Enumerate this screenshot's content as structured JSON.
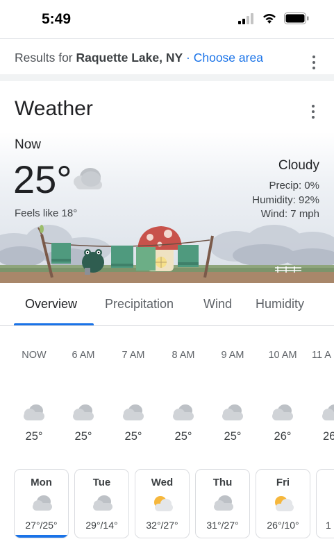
{
  "status": {
    "time": "5:49"
  },
  "results": {
    "prefix": "Results for ",
    "location": "Raquette Lake, NY",
    "separator": " · ",
    "choose_area": "Choose area"
  },
  "weather": {
    "title": "Weather",
    "now_label": "Now",
    "temperature": "25°",
    "feels_like": "Feels like 18°",
    "condition": "Cloudy",
    "precip": "Precip: 0%",
    "humidity": "Humidity: 92%",
    "wind": "Wind: 7 mph",
    "condition_icon": "cloud-icon"
  },
  "tabs": [
    {
      "label": "Overview",
      "active": true
    },
    {
      "label": "Precipitation",
      "active": false
    },
    {
      "label": "Wind",
      "active": false
    },
    {
      "label": "Humidity",
      "active": false
    }
  ],
  "hourly": [
    {
      "time": "NOW",
      "temp": "25°",
      "icon": "cloud-icon"
    },
    {
      "time": "6 AM",
      "temp": "25°",
      "icon": "cloud-icon"
    },
    {
      "time": "7 AM",
      "temp": "25°",
      "icon": "cloud-icon"
    },
    {
      "time": "8 AM",
      "temp": "25°",
      "icon": "cloud-icon"
    },
    {
      "time": "9 AM",
      "temp": "25°",
      "icon": "cloud-icon"
    },
    {
      "time": "10 AM",
      "temp": "26°",
      "icon": "cloud-icon"
    },
    {
      "time": "11 A",
      "temp": "26",
      "icon": "cloud-icon"
    }
  ],
  "daily": [
    {
      "day": "Mon",
      "temps": "27°/25°",
      "icon": "cloud-icon",
      "selected": true
    },
    {
      "day": "Tue",
      "temps": "29°/14°",
      "icon": "cloud-icon",
      "selected": false
    },
    {
      "day": "Wed",
      "temps": "32°/27°",
      "icon": "partly-sunny-icon",
      "selected": false
    },
    {
      "day": "Thu",
      "temps": "31°/27°",
      "icon": "cloud-icon",
      "selected": false
    },
    {
      "day": "Fri",
      "temps": "26°/10°",
      "icon": "partly-sunny-icon",
      "selected": false
    },
    {
      "day": "",
      "temps": "1",
      "icon": "",
      "selected": false
    }
  ],
  "colors": {
    "accent": "#1a73e8",
    "link": "#1a73e8",
    "divider": "#dadce0"
  }
}
